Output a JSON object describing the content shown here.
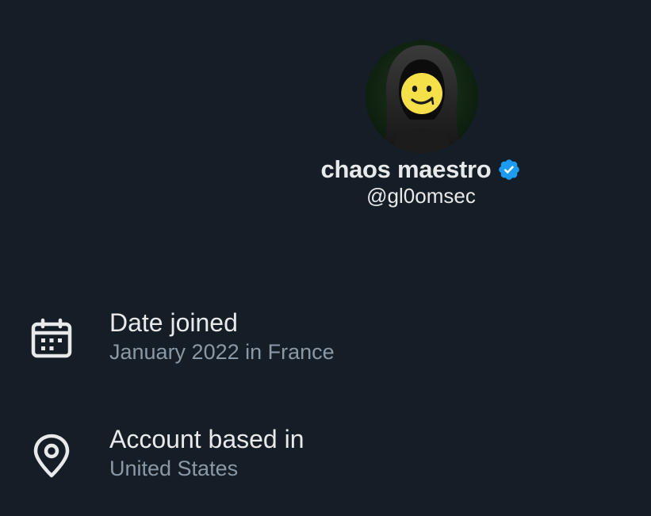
{
  "profile": {
    "display_name": "chaos maestro",
    "handle": "@gl0omsec",
    "verified_badge_color": "#1d9bf0",
    "avatar_icon": "hooded-figure-smiley-avatar"
  },
  "info": [
    {
      "icon": "calendar-icon",
      "title": "Date joined",
      "value": "January 2022 in France"
    },
    {
      "icon": "location-pin-icon",
      "title": "Account based in",
      "value": "United States"
    }
  ],
  "colors": {
    "background": "#151d27",
    "primary_text": "#e7e9ea",
    "secondary_text": "#8b98a5",
    "accent": "#1d9bf0"
  }
}
